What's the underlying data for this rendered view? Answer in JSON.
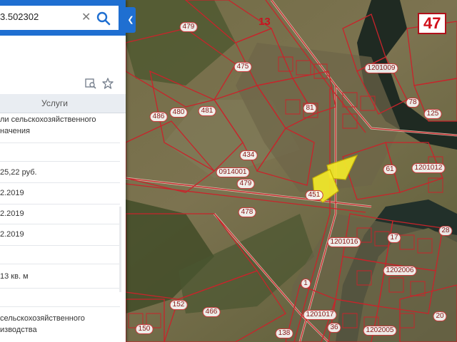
{
  "search": {
    "value": "3.502302",
    "clear_glyph": "✕"
  },
  "panel": {
    "tab_label": "Услуги",
    "lines": [
      "ли сельскохозяйственного",
      "начения",
      "25,22 руб.",
      "2.2019",
      "2.2019",
      "2.2019",
      "13 кв. м",
      "сельскохозяйственного",
      "изводства"
    ]
  },
  "map": {
    "parcel_labels": [
      "479",
      "475",
      "1201009",
      "486",
      "480",
      "481",
      "81",
      "434",
      "0914001",
      "479",
      "478",
      "451",
      "61",
      "1201012",
      "78",
      "125",
      "1201016",
      "17",
      "1202006",
      "1",
      "152",
      "466",
      "150",
      "1201017",
      "1202005",
      "138",
      "36",
      "28",
      "20"
    ],
    "big_label": "47",
    "road_label": "13",
    "accent": "#c8242b",
    "highlight": "#f3ea2a"
  },
  "icons": [
    "search-icon",
    "close-icon",
    "chevron-left-icon",
    "locate-list-icon",
    "star-icon"
  ]
}
